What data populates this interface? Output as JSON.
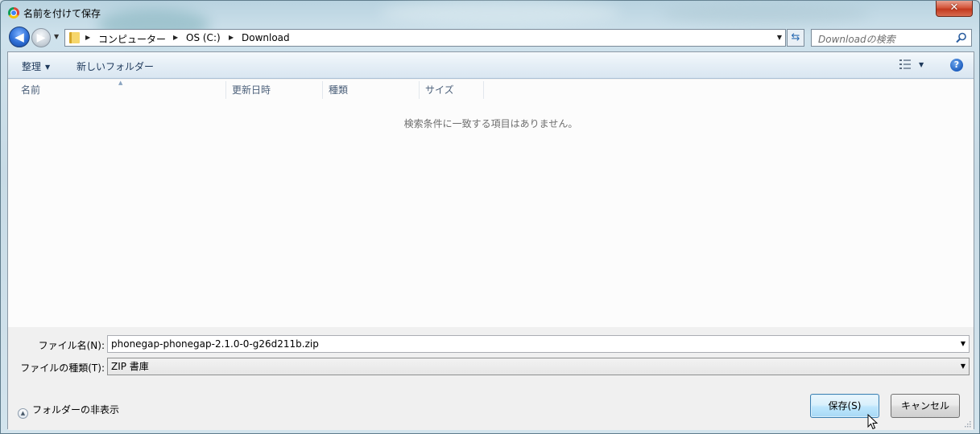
{
  "window": {
    "title": "名前を付けて保存",
    "close_label": "✕"
  },
  "nav": {
    "back_icon": "back-arrow-icon",
    "forward_icon": "forward-arrow-icon",
    "breadcrumbs": [
      "コンピューター",
      "OS (C:)",
      "Download"
    ]
  },
  "search": {
    "placeholder": "Downloadの検索"
  },
  "toolbar": {
    "organize_label": "整理",
    "new_folder_label": "新しいフォルダー"
  },
  "file_list": {
    "columns": [
      "名前",
      "更新日時",
      "種類",
      "サイズ"
    ],
    "empty_message": "検索条件に一致する項目はありません。"
  },
  "form": {
    "filename_label": "ファイル名(N):",
    "filename_value": "phonegap-phonegap-2.1.0-0-g26d211b.zip",
    "filetype_label": "ファイルの種類(T):",
    "filetype_value": "ZIP 書庫"
  },
  "footer": {
    "hide_folders_label": "フォルダーの非表示",
    "save_label": "保存(S)",
    "cancel_label": "キャンセル"
  },
  "colors": {
    "accent": "#3c7fb1",
    "close_red": "#c23a1f"
  }
}
